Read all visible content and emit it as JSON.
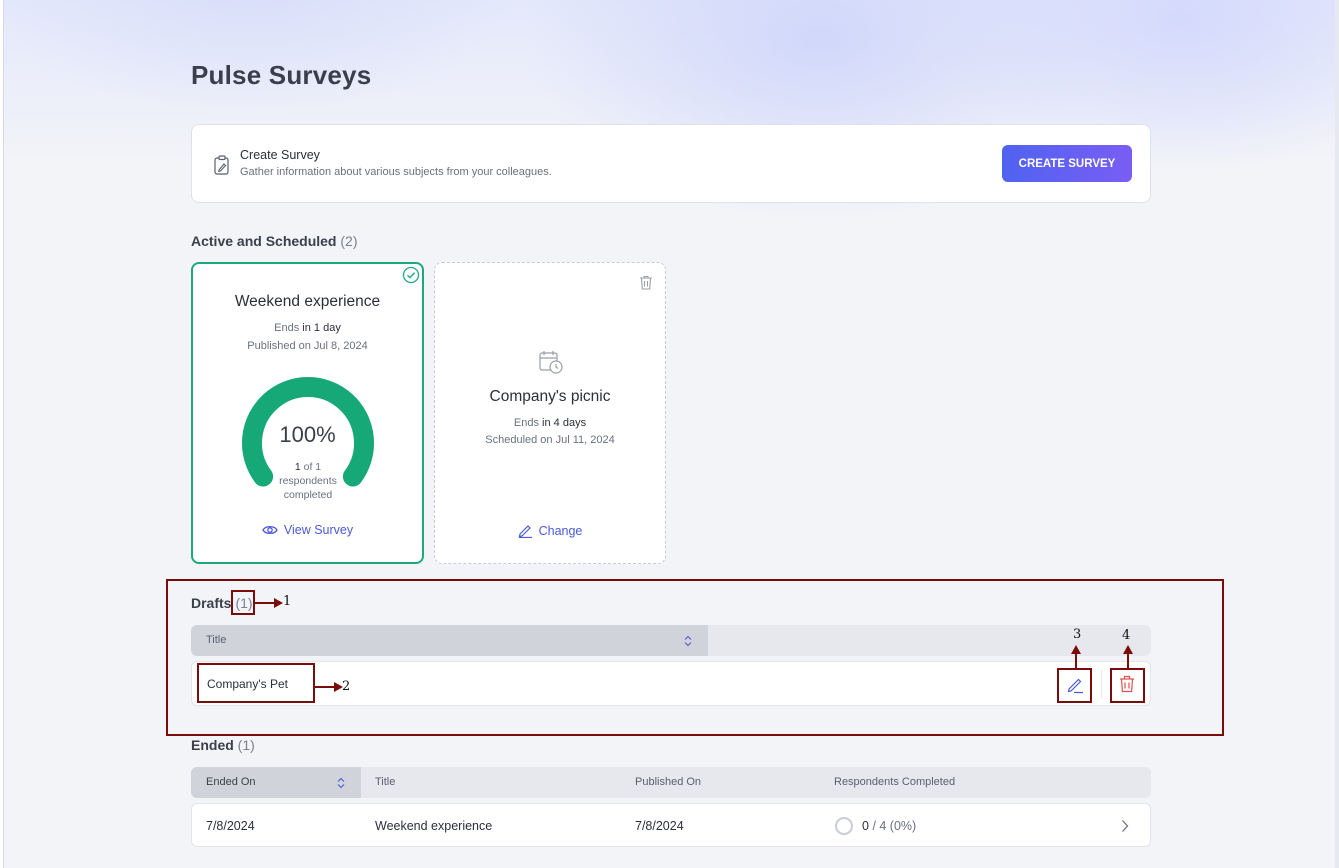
{
  "page": {
    "title": "Pulse Surveys"
  },
  "create": {
    "title": "Create Survey",
    "subtitle": "Gather information about various subjects from your colleagues.",
    "button_label": "CREATE SURVEY",
    "icon": "clipboard-pen-icon"
  },
  "active": {
    "title": "Active and Scheduled",
    "count": "(2)",
    "cards": [
      {
        "name": "Weekend experience",
        "ends_prefix": "Ends",
        "ends_value": "in 1 day",
        "published": "Published on Jul 8, 2024",
        "percent": "100%",
        "progress_fraction": 1.0,
        "respondents_count": "1",
        "respondents_rest": "of 1",
        "respondents_line2": "respondents",
        "respondents_line3": "completed",
        "link_label": "View Survey",
        "status_icon": "check-circle-icon"
      },
      {
        "name": "Company's picnic",
        "ends_prefix": "Ends",
        "ends_value": "in 4 days",
        "scheduled": "Scheduled on Jul 11, 2024",
        "link_label": "Change",
        "icon": "calendar-clock-icon"
      }
    ]
  },
  "drafts": {
    "title": "Drafts",
    "count": "(1)",
    "column_title": "Title",
    "rows": [
      {
        "title": "Company's Pet"
      }
    ]
  },
  "ended": {
    "title": "Ended",
    "count": "(1)",
    "columns": [
      "Ended On",
      "Title",
      "Published On",
      "Respondents Completed"
    ],
    "rows": [
      {
        "ended_on": "7/8/2024",
        "title": "Weekend experience",
        "published_on": "7/8/2024",
        "respondents_count": "0",
        "respondents_rest": "/ 4 (0%)"
      }
    ]
  },
  "annotations": {
    "labels": [
      "1",
      "2",
      "3",
      "4"
    ]
  },
  "colors": {
    "accent": "#4f63f0",
    "success": "#1ea97c",
    "danger": "#e05252",
    "annotation": "#7a0c0c"
  }
}
